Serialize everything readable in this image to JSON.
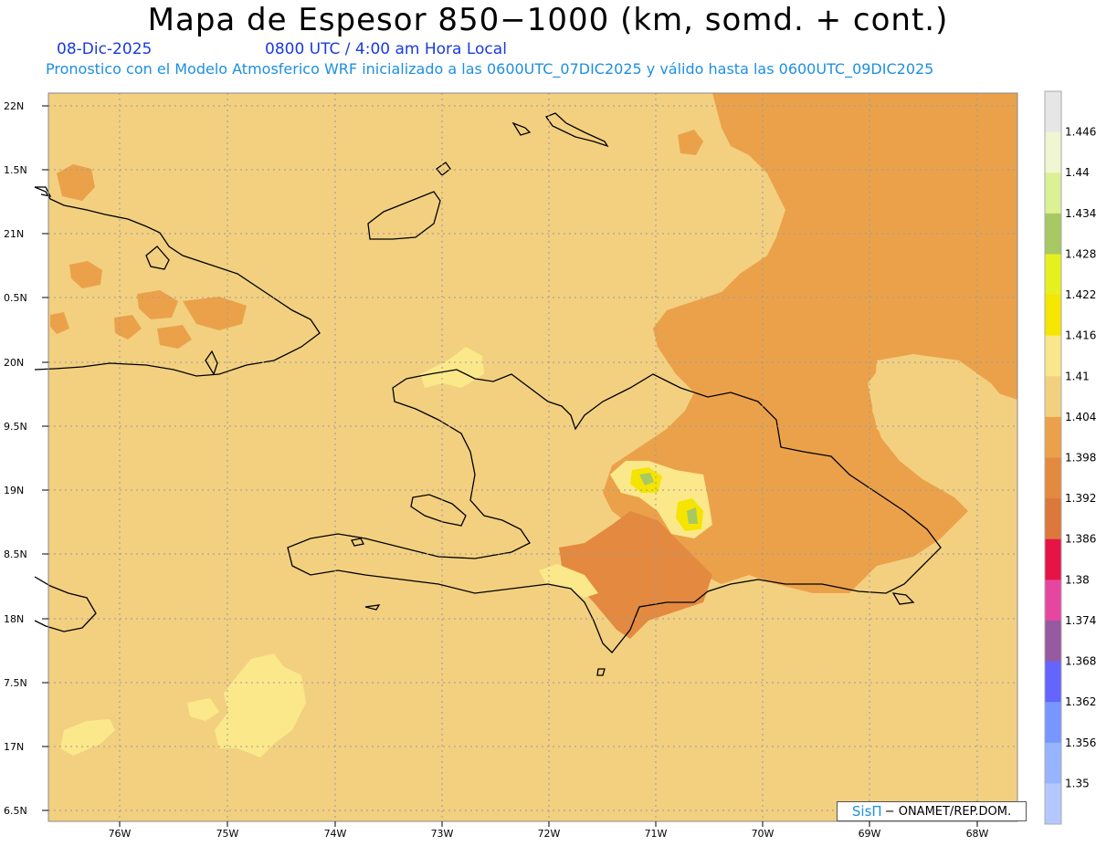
{
  "header": {
    "title": "Mapa de Espesor 850−1000 (km, somd. + cont.)",
    "date": "08-Dic-2025",
    "time": "0800 UTC / 4:00 am Hora Local",
    "description": "Pronostico con el Modelo Atmosferico WRF inicializado a las 0600UTC_07DIC2025 y válido hasta las  0600UTC_09DIC2025"
  },
  "map": {
    "lat_labels": [
      "22N",
      "1.5N",
      "21N",
      "0.5N",
      "20N",
      "9.5N",
      "19N",
      "8.5N",
      "18N",
      "7.5N",
      "17N",
      "6.5N"
    ],
    "lon_labels": [
      "76W",
      "75W",
      "74W",
      "73W",
      "72W",
      "71W",
      "70W",
      "69W",
      "68W"
    ],
    "colors": {
      "c1404": "#f2d080",
      "c1398": "#eba14a",
      "c1392": "#e38a40",
      "c1410": "#fbe88a",
      "c1416": "#f5e400",
      "c1428": "#a8c860"
    }
  },
  "colorbar": {
    "levels": [
      "1.446",
      "1.44",
      "1.434",
      "1.428",
      "1.422",
      "1.416",
      "1.41",
      "1.404",
      "1.398",
      "1.392",
      "1.386",
      "1.38",
      "1.374",
      "1.368",
      "1.362",
      "1.356",
      "1.35"
    ],
    "colors": [
      "#e6e6e6",
      "#f0f5d2",
      "#dcf096",
      "#a8c864",
      "#e6f01e",
      "#f5e600",
      "#fae68c",
      "#f2d080",
      "#eba14a",
      "#e38a40",
      "#dc783c",
      "#e61446",
      "#e646a0",
      "#965aa0",
      "#6464ff",
      "#7896ff",
      "#96b4ff",
      "#b4c8ff"
    ]
  },
  "credit": {
    "brand": "SisΠ",
    "text": "− ONAMET/REP.DOM."
  }
}
